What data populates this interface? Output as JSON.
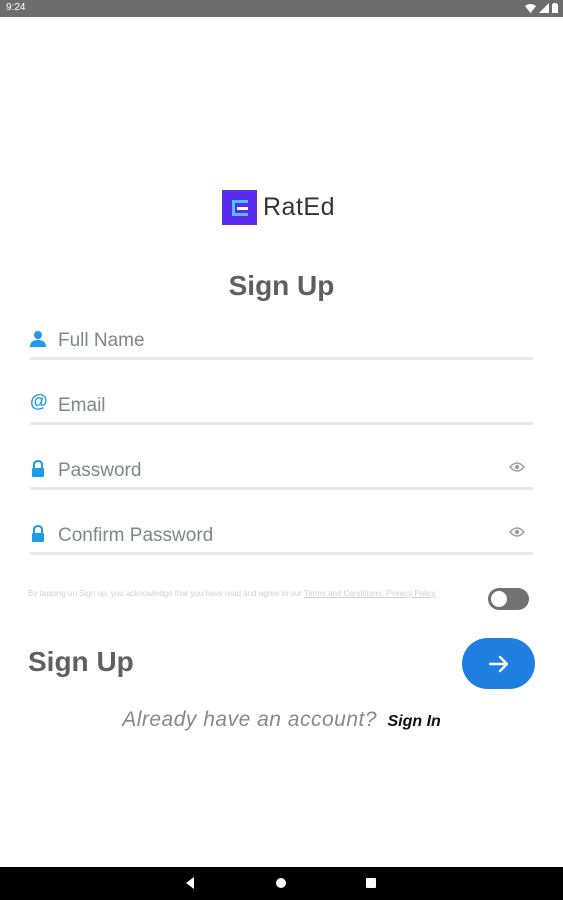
{
  "status_bar": {
    "time": "9:24"
  },
  "logo": {
    "name": "RatEd"
  },
  "page": {
    "title": "Sign Up"
  },
  "form": {
    "full_name_placeholder": "Full Name",
    "email_placeholder": "Email",
    "password_placeholder": "Password",
    "confirm_password_placeholder": "Confirm Password"
  },
  "terms": {
    "text": "By tapping on Sign up, you acknowledge that you have read and agree to our ",
    "link": "Terms and Conditions, Privacy Policy",
    "accepted": false
  },
  "action": {
    "signup_label": "Sign Up",
    "submit_icon": "arrow-right-icon"
  },
  "footer": {
    "prompt": "Already have an account?",
    "signin_link": "Sign In"
  },
  "colors": {
    "accent": "#1f7fe0",
    "brand": "#5b2bf2",
    "field_icon": "#1e9be9"
  }
}
